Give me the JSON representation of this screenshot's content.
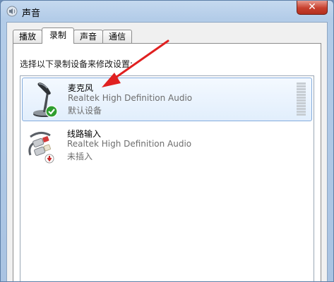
{
  "window": {
    "title": "声音",
    "close_glyph": "✕"
  },
  "tabs": [
    {
      "label": "播放",
      "active": false
    },
    {
      "label": "录制",
      "active": true
    },
    {
      "label": "声音",
      "active": false
    },
    {
      "label": "通信",
      "active": false
    }
  ],
  "recording": {
    "instruction": "选择以下录制设备来修改设置:",
    "devices": [
      {
        "name": "麦克风",
        "driver": "Realtek High Definition Audio",
        "status": "默认设备",
        "icon": "microphone-icon",
        "badge": "default-check-icon",
        "selected": true
      },
      {
        "name": "线路输入",
        "driver": "Realtek High Definition Audio",
        "status": "未插入",
        "icon": "line-in-cable-icon",
        "badge": "unplugged-icon",
        "selected": false
      }
    ]
  },
  "colors": {
    "accent_arrow": "#e02020",
    "selection": "#e1eefc",
    "close_button": "#c7402e"
  }
}
